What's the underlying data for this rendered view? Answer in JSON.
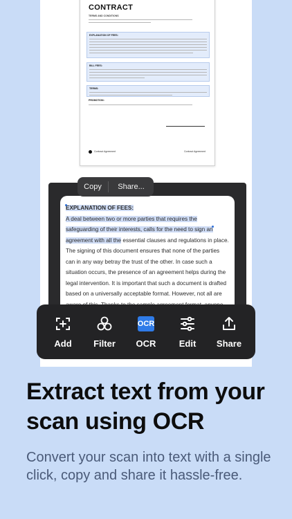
{
  "document": {
    "title": "CONTRACT",
    "subtitle": "TERMS AND CONDITIONS",
    "sections": [
      {
        "heading": "EXPLANATION OF FEES:"
      },
      {
        "heading": "BILL FEES:"
      },
      {
        "heading": "TERMS:"
      }
    ],
    "promotion_heading": "PROMOTION:",
    "footer_left": "Contract Agreement",
    "footer_right": "Contract Agreement"
  },
  "context_menu": {
    "copy_label": "Copy",
    "share_label": "Share..."
  },
  "ocr_result": {
    "heading": "EXPLANATION OF FEES:",
    "selected_text": "A deal between two or more parties that requires the safeguarding of their interests, calls for the need to sign an agreement with all the",
    "body_text": " essential clauses and regulations in place. The signing of this document ensures that none of the parties can in any way betray the trust of the other. In case such a situation occurs, the presence of an agreement helps during the legal intervention. It is important that such a document is drafted based on a universally acceptable format. However, not all are aware of this. Thanks to the sample agreement format, anyone can now easily draft an agreement without the help of an expert as this sample gives them an idea of the layout of the document and the sections"
  },
  "toolbar": {
    "items": [
      {
        "label": "Add",
        "icon": "add-scan-icon"
      },
      {
        "label": "Filter",
        "icon": "filter-icon"
      },
      {
        "label": "OCR",
        "icon": "ocr-icon",
        "badge_text": "OCR",
        "active_color": "#2f7be8"
      },
      {
        "label": "Edit",
        "icon": "sliders-icon"
      },
      {
        "label": "Share",
        "icon": "share-icon"
      }
    ]
  },
  "promo": {
    "headline": "Extract text from your scan using OCR",
    "subline": "Convert your scan into text with a single click, copy and share it hassle-free."
  },
  "colors": {
    "background": "#c9dcf7",
    "toolbar": "#232325",
    "accent": "#2f7be8",
    "selection": "#cfdcf5"
  }
}
